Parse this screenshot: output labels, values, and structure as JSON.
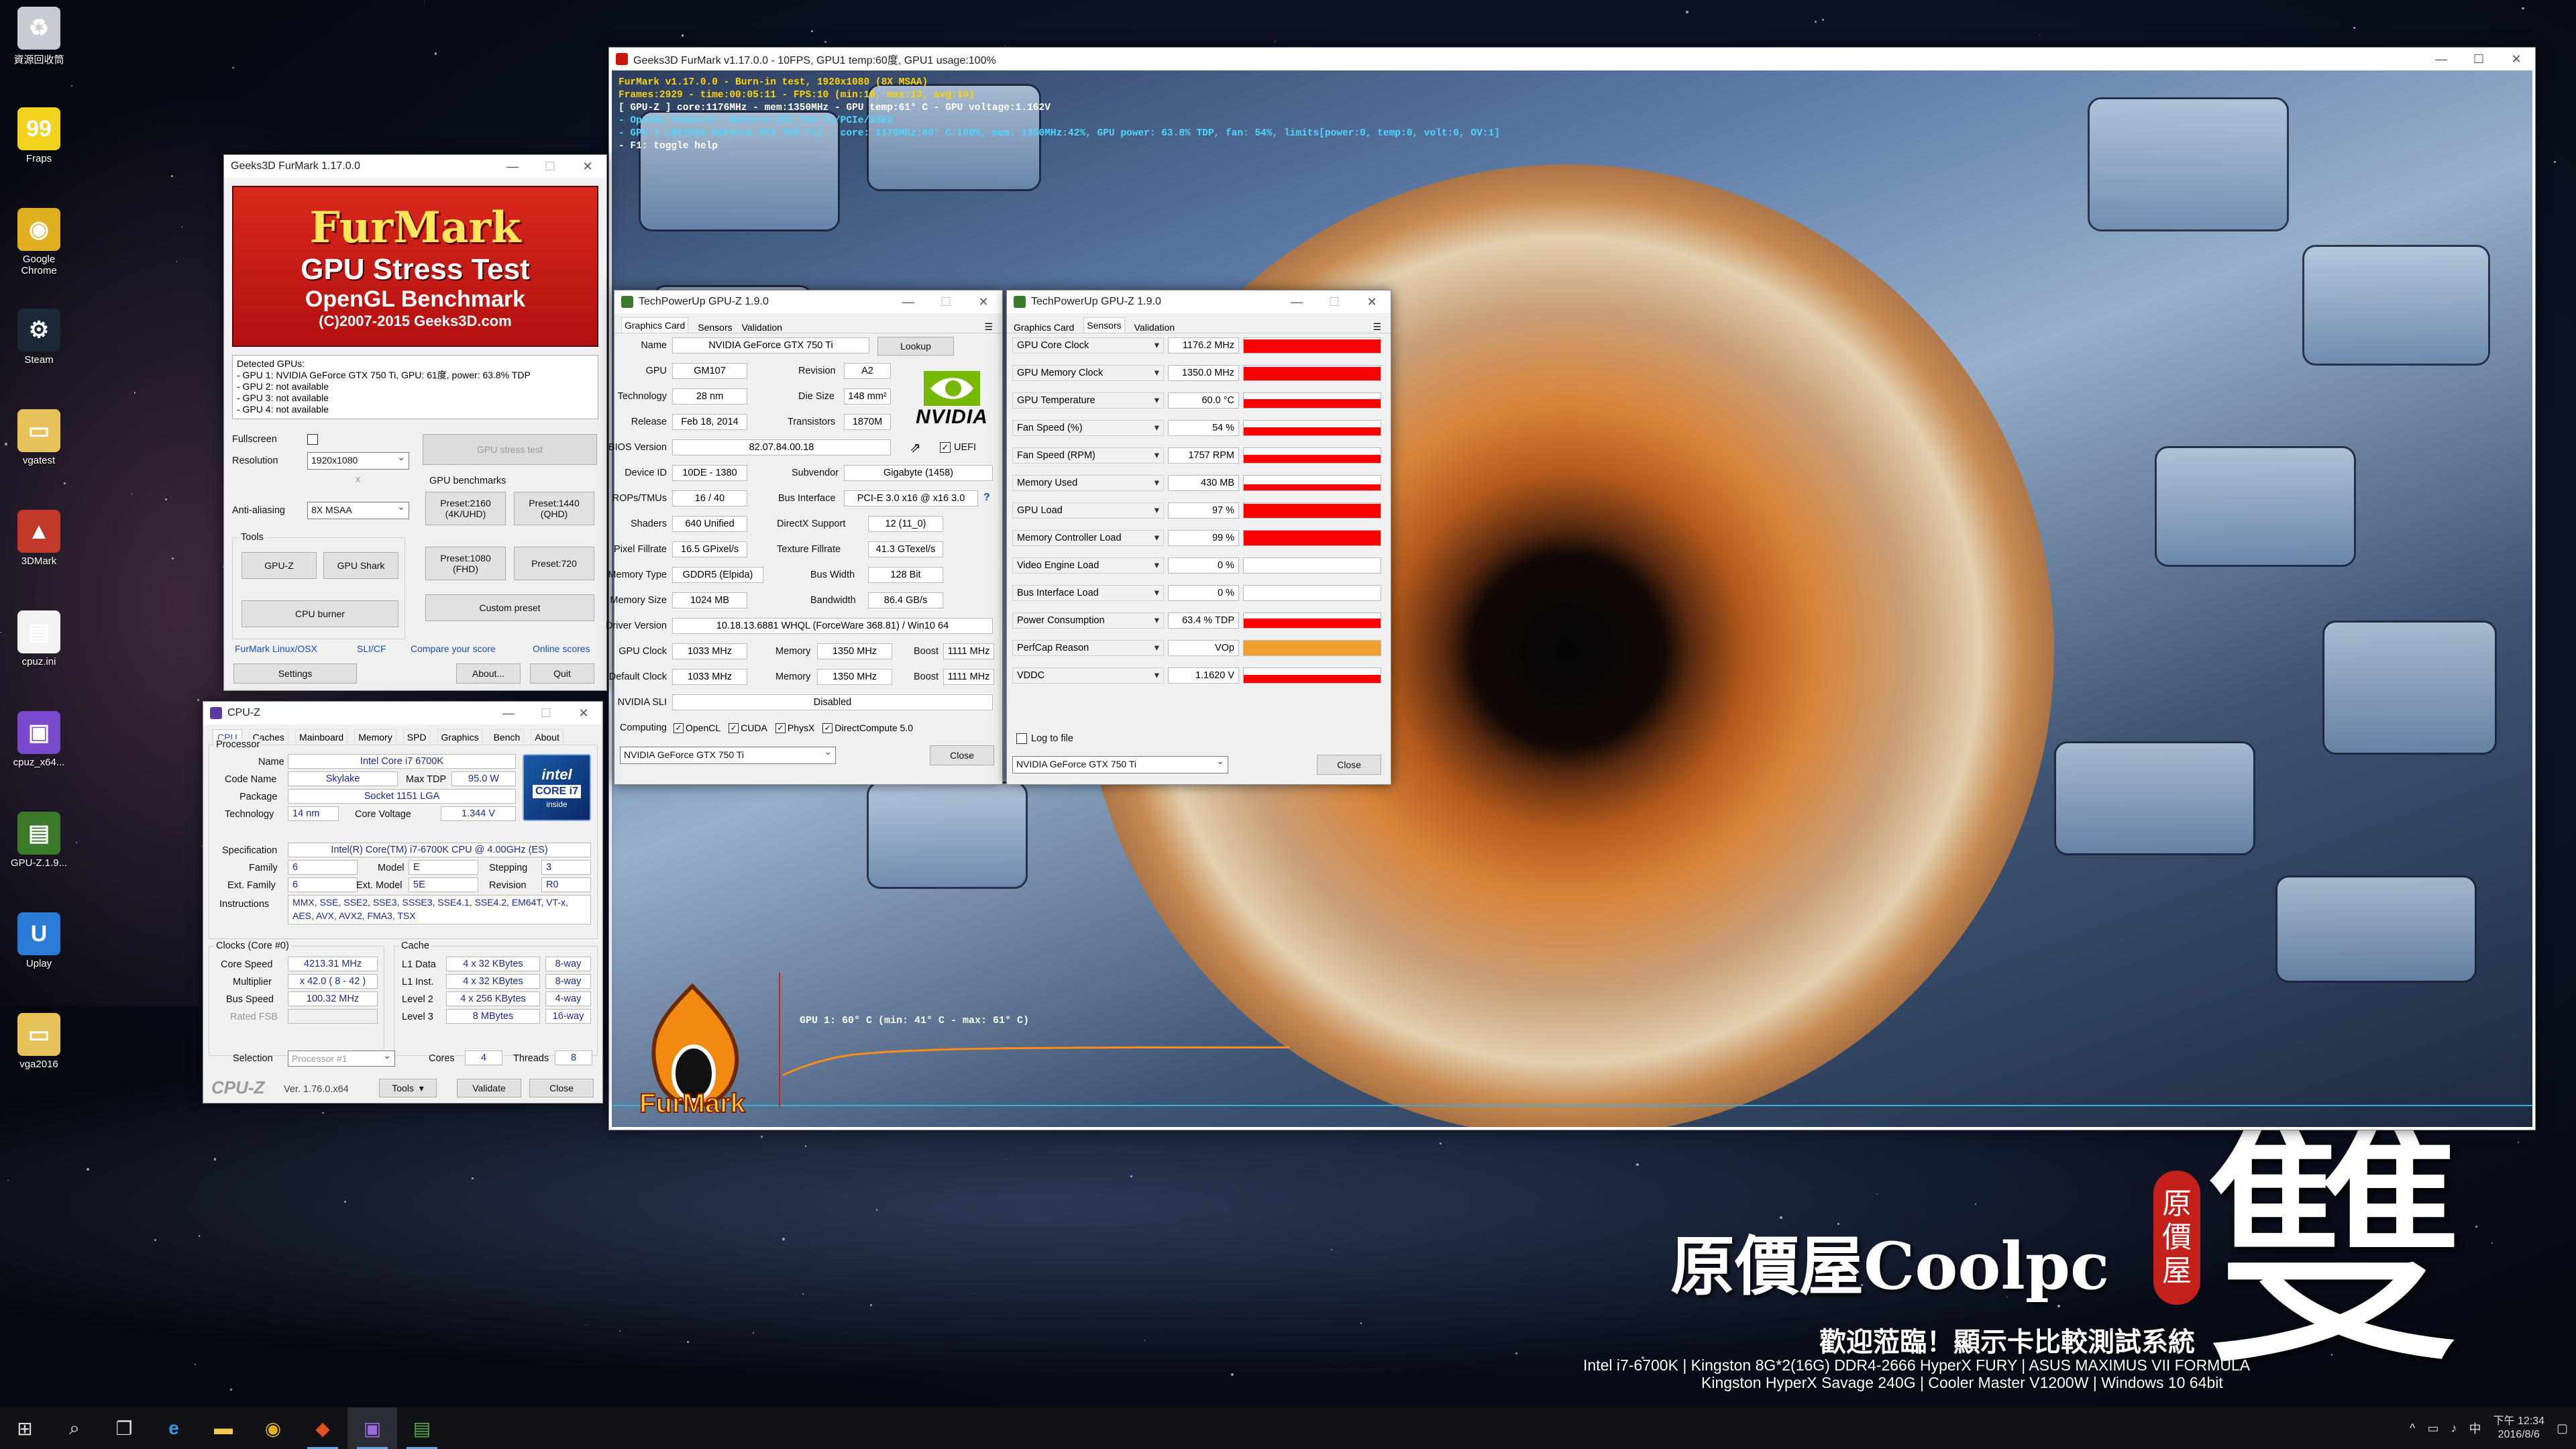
{
  "desktop": {
    "icons": [
      {
        "label": "資源回收筒",
        "icon": "recycle-bin"
      },
      {
        "label": "Fraps",
        "icon": "fraps"
      },
      {
        "label": "Google Chrome",
        "icon": "chrome"
      },
      {
        "label": "Steam",
        "icon": "steam"
      },
      {
        "label": "vgatest",
        "icon": "folder"
      },
      {
        "label": "3DMark",
        "icon": "3dmark"
      },
      {
        "label": "cpuz.ini",
        "icon": "file"
      },
      {
        "label": "cpuz_x64...",
        "icon": "cpuz"
      },
      {
        "label": "GPU-Z.1.9...",
        "icon": "gpuz"
      },
      {
        "label": "Uplay",
        "icon": "uplay"
      },
      {
        "label": "vga2016",
        "icon": "folder"
      }
    ]
  },
  "furmark_main": {
    "title": "Geeks3D FurMark v1.17.0.0 - 10FPS, GPU1 temp:60度, GPU1 usage:100%",
    "osd": [
      {
        "text": "FurMark v1.17.0.0 - Burn-in test, 1920x1080 (8X MSAA)",
        "color": "#ffd200"
      },
      {
        "text": "Frames:2929 - time:00:05:11 - FPS:10 (min:10, max:13, avg:10)",
        "color": "#ffd200"
      },
      {
        "text": "[ GPU-Z ] core:1176MHz - mem:1350MHz - GPU temp:61° C - GPU voltage:1.162V",
        "color": "#ffffff"
      },
      {
        "text": "- OpenGL renderer: GeForce GTX 750 Ti/PCIe/SSE2",
        "color": "#4fd6ff"
      },
      {
        "text": "- GPU 1 (NVIDIA GeForce GTX 750 Ti) - core: 1176MHz:60° C:100%, mem: 1350MHz:42%, GPU power: 63.8% TDP, fan: 54%, limits[power:0, temp:0, volt:0, OV:1]",
        "color": "#4fd6ff"
      },
      {
        "text": "- F1: toggle help",
        "color": "#ffffff"
      }
    ],
    "graph_label": "GPU 1: 60° C (min: 41° C - max: 61° C)",
    "graph_temps": [
      41,
      46,
      50,
      53,
      55,
      56,
      57,
      57.5,
      58,
      58.5,
      58.8,
      59,
      59.2,
      59.4,
      59.5,
      59.6,
      59.7,
      59.8,
      59.8,
      59.9,
      60,
      60,
      60,
      60,
      60,
      60,
      60,
      60,
      60,
      60
    ],
    "graph_color": "#ff8c1a",
    "logo_text": "FurMark"
  },
  "furmark_launcher": {
    "title": "Geeks3D FurMark 1.17.0.0",
    "banner": {
      "line1": "FurMark",
      "line2": "GPU Stress Test",
      "line3": "OpenGL Benchmark",
      "line4": "(C)2007-2015 Geeks3D.com"
    },
    "detected_label": "Detected GPUs:",
    "gpus": [
      "- GPU 1: NVIDIA GeForce GTX 750 Ti, GPU: 61度, power: 63.8% TDP",
      "- GPU 2: not available",
      "- GPU 3: not available",
      "- GPU 4: not available"
    ],
    "fullscreen_label": "Fullscreen",
    "resolution_label": "Resolution",
    "resolution_value": "1920x1080",
    "x_label": "x",
    "aa_label": "Anti-aliasing",
    "aa_value": "8X MSAA",
    "tools_label": "Tools",
    "gpu_stress_test": "GPU stress test",
    "gpu_benchmarks_label": "GPU benchmarks",
    "preset2160": "Preset:2160\n(4K/UHD)",
    "preset1440": "Preset:1440\n(QHD)",
    "preset1080": "Preset:1080\n(FHD)",
    "preset720": "Preset:720",
    "gpuz_btn": "GPU-Z",
    "gpushark_btn": "GPU Shark",
    "cpuburner_btn": "CPU burner",
    "custom_preset": "Custom preset",
    "links": [
      "FurMark Linux/OSX",
      "SLI/CF",
      "Compare your score",
      "Online scores"
    ],
    "settings": "Settings",
    "about": "About...",
    "quit": "Quit"
  },
  "gpuz_card": {
    "title": "TechPowerUp GPU-Z 1.9.0",
    "tabs": [
      "Graphics Card",
      "Sensors",
      "Validation"
    ],
    "active_tab": 0,
    "name_label": "Name",
    "name": "NVIDIA GeForce GTX 750 Ti",
    "lookup": "Lookup",
    "gpu_label": "GPU",
    "gpu": "GM107",
    "revision_label": "Revision",
    "revision": "A2",
    "tech_label": "Technology",
    "tech": "28 nm",
    "diesize_label": "Die Size",
    "diesize": "148 mm²",
    "release_label": "Release",
    "release": "Feb 18, 2014",
    "transistors_label": "Transistors",
    "transistors": "1870M",
    "bios_label": "BIOS Version",
    "bios": "82.07.84.00.18",
    "uefi": "UEFI",
    "deviceid_label": "Device ID",
    "deviceid": "10DE - 1380",
    "subvendor_label": "Subvendor",
    "subvendor": "Gigabyte (1458)",
    "rops_label": "ROPs/TMUs",
    "rops": "16 / 40",
    "bus_label": "Bus Interface",
    "bus": "PCI-E 3.0 x16 @ x16 3.0",
    "shaders_label": "Shaders",
    "shaders": "640 Unified",
    "dx_label": "DirectX Support",
    "dx": "12 (11_0)",
    "pixel_label": "Pixel Fillrate",
    "pixel": "16.5 GPixel/s",
    "texture_label": "Texture Fillrate",
    "texture": "41.3 GTexel/s",
    "memtype_label": "Memory Type",
    "memtype": "GDDR5 (Elpida)",
    "buswidth_label": "Bus Width",
    "buswidth": "128 Bit",
    "memsize_label": "Memory Size",
    "memsize": "1024 MB",
    "bandwidth_label": "Bandwidth",
    "bandwidth": "86.4 GB/s",
    "driver_label": "Driver Version",
    "driver": "10.18.13.6881 WHQL (ForceWare 368.81) / Win10 64",
    "gpuclock_label": "GPU Clock",
    "gpuclock": "1033 MHz",
    "memory_label": "Memory",
    "gpuclock_mem": "1350 MHz",
    "boost_label": "Boost",
    "gpuclock_boost": "1111 MHz",
    "defclock_label": "Default Clock",
    "defclock": "1033 MHz",
    "defclock_mem": "1350 MHz",
    "defclock_boost": "1111 MHz",
    "sli_label": "NVIDIA SLI",
    "sli": "Disabled",
    "computing_label": "Computing",
    "computing": [
      "OpenCL",
      "CUDA",
      "PhysX",
      "DirectCompute 5.0"
    ],
    "select": "NVIDIA GeForce GTX 750 Ti",
    "close": "Close",
    "vendor_logo": "NVIDIA"
  },
  "gpuz_sensors": {
    "title": "TechPowerUp GPU-Z 1.9.0",
    "tabs": [
      "Graphics Card",
      "Sensors",
      "Validation"
    ],
    "active_tab": 1,
    "sensors": [
      {
        "label": "GPU Core Clock",
        "value": "1176.2 MHz",
        "level": 0.92,
        "color": "#ff0000"
      },
      {
        "label": "GPU Memory Clock",
        "value": "1350.0 MHz",
        "level": 0.92,
        "color": "#ff0000"
      },
      {
        "label": "GPU Temperature",
        "value": "60.0 °C",
        "level": 0.6,
        "color": "#ff0000"
      },
      {
        "label": "Fan Speed (%)",
        "value": "54 %",
        "level": 0.54,
        "color": "#ff0000"
      },
      {
        "label": "Fan Speed (RPM)",
        "value": "1757 RPM",
        "level": 0.55,
        "color": "#ff0000"
      },
      {
        "label": "Memory Used",
        "value": "430 MB",
        "level": 0.42,
        "color": "#ff0000"
      },
      {
        "label": "GPU Load",
        "value": "97 %",
        "level": 0.97,
        "color": "#ff0000"
      },
      {
        "label": "Memory Controller Load",
        "value": "99 %",
        "level": 0.99,
        "color": "#ff0000"
      },
      {
        "label": "Video Engine Load",
        "value": "0 %",
        "level": 0,
        "color": "#ff0000"
      },
      {
        "label": "Bus Interface Load",
        "value": "0 %",
        "level": 0,
        "color": "#ff0000"
      },
      {
        "label": "Power Consumption",
        "value": "63.4 % TDP",
        "level": 0.63,
        "color": "#ff0000"
      },
      {
        "label": "PerfCap Reason",
        "value": "VOp",
        "level": 1,
        "color": "#f0a030"
      },
      {
        "label": "VDDC",
        "value": "1.1620 V",
        "level": 0.55,
        "color": "#ff0000"
      }
    ],
    "log_label": "Log to file",
    "select": "NVIDIA GeForce GTX 750 Ti",
    "close": "Close"
  },
  "cpuz": {
    "title": "CPU-Z",
    "tabs": [
      "CPU",
      "Caches",
      "Mainboard",
      "Memory",
      "SPD",
      "Graphics",
      "Bench",
      "About"
    ],
    "processor_label": "Processor",
    "name_label": "Name",
    "name": "Intel Core i7 6700K",
    "codename_label": "Code Name",
    "codename": "Skylake",
    "maxtdp_label": "Max TDP",
    "maxtdp": "95.0 W",
    "package_label": "Package",
    "package": "Socket 1151 LGA",
    "tech_label": "Technology",
    "tech": "14 nm",
    "corevolt_label": "Core Voltage",
    "corevolt": "1.344 V",
    "spec_label": "Specification",
    "spec": "Intel(R) Core(TM) i7-6700K CPU @ 4.00GHz (ES)",
    "family_label": "Family",
    "family": "6",
    "model_label": "Model",
    "model": "E",
    "stepping_label": "Stepping",
    "stepping": "3",
    "extfamily_label": "Ext. Family",
    "extfamily": "6",
    "extmodel_label": "Ext. Model",
    "extmodel": "5E",
    "revision_label": "Revision",
    "revision": "R0",
    "instr_label": "Instructions",
    "instr": "MMX, SSE, SSE2, SSE3, SSSE3, SSE4.1, SSE4.2, EM64T, VT-x, AES, AVX, AVX2, FMA3, TSX",
    "clocks_label": "Clocks (Core #0)",
    "corespeed_label": "Core Speed",
    "corespeed": "4213.31 MHz",
    "mult_label": "Multiplier",
    "mult": "x 42.0 ( 8 - 42 )",
    "busspeed_label": "Bus Speed",
    "busspeed": "100.32 MHz",
    "ratedfsb_label": "Rated FSB",
    "ratedfsb": "",
    "cache_label": "Cache",
    "cache": [
      {
        "label": "L1 Data",
        "size": "4 x 32 KBytes",
        "way": "8-way"
      },
      {
        "label": "L1 Inst.",
        "size": "4 x 32 KBytes",
        "way": "8-way"
      },
      {
        "label": "Level 2",
        "size": "4 x 256 KBytes",
        "way": "4-way"
      },
      {
        "label": "Level 3",
        "size": "8 MBytes",
        "way": "16-way"
      }
    ],
    "selection_label": "Selection",
    "selection": "Processor #1",
    "cores_label": "Cores",
    "cores": "4",
    "threads_label": "Threads",
    "threads": "8",
    "brand": "CPU-Z",
    "version": "Ver. 1.76.0.x64",
    "tools": "Tools",
    "validate": "Validate",
    "close": "Close",
    "intel_badge": {
      "l1": "intel",
      "l2": "CORE i7",
      "l3": "inside"
    }
  },
  "watermark": {
    "brand": "原價屋Coolpc",
    "big_char": "雙",
    "seal": [
      "原",
      "價",
      "屋"
    ],
    "welcome": "歡迎蒞臨！顯示卡比較測試系統",
    "spec1": "Intel i7-6700K | Kingston 8G*2(16G) DDR4-2666 HyperX FURY | ASUS MAXIMUS VII FORMULA",
    "spec2": "Kingston HyperX Savage 240G | Cooler Master V1200W | Windows 10 64bit"
  },
  "taskbar": {
    "apps": [
      "start-icon",
      "search-icon",
      "task-view-icon",
      "edge-icon",
      "explorer-icon",
      "chrome-icon",
      "furmark-icon",
      "cpuz-icon",
      "gpuz-icon"
    ],
    "time_line1": "下午 12:34",
    "time_line2": "2016/8/6"
  }
}
